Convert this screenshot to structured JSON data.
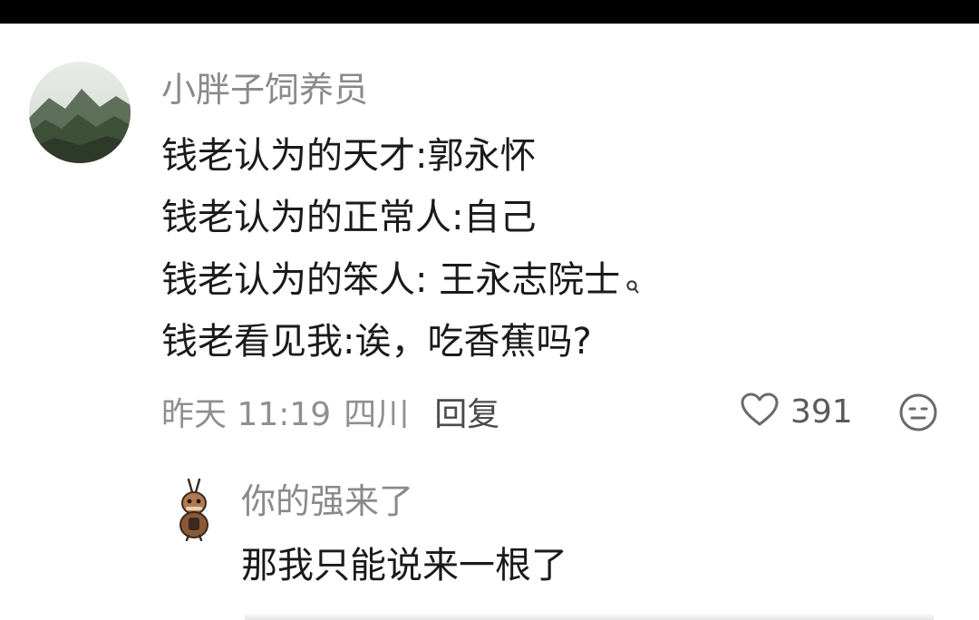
{
  "comment": {
    "username": "小胖子饲养员",
    "lines": [
      "钱老认为的天才:郭永怀",
      "钱老认为的正常人:自己",
      "钱老认为的笨人: 王永志院士",
      "钱老看见我:诶，吃香蕉吗?"
    ],
    "time": "昨天 11:19",
    "location": "四川",
    "reply_label": "回复",
    "like_count": "391",
    "icons": {
      "avatar": "landscape-avatar",
      "search_hint": "search-icon",
      "like": "heart-icon",
      "emoji": "emoji-icon"
    }
  },
  "reply": {
    "username": "你的强来了",
    "text": "那我只能说来一根了",
    "icons": {
      "avatar": "cartoon-avatar"
    }
  }
}
